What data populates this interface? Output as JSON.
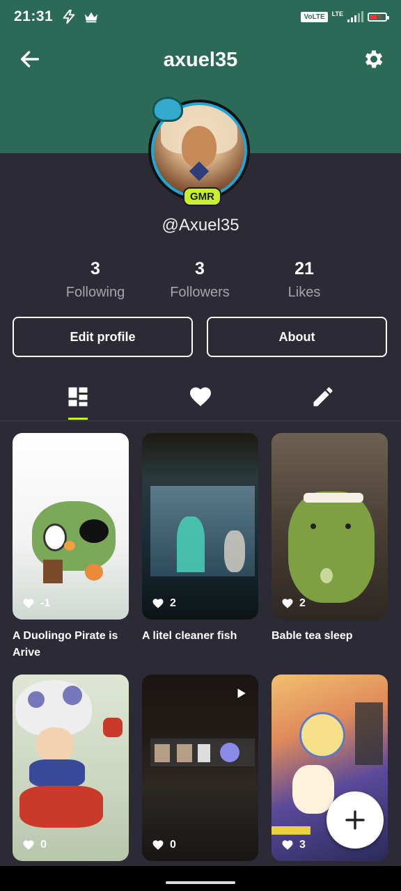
{
  "status_bar": {
    "time": "21:31",
    "icons": [
      "bolt-icon",
      "crown-icon"
    ],
    "volte": "VoLTE",
    "network": "LTE",
    "battery_text": "15"
  },
  "header": {
    "title": "axuel35",
    "back_icon": "back-arrow-icon",
    "settings_icon": "gear-icon",
    "color": "#2b6a56"
  },
  "profile": {
    "badge": "GMR",
    "handle": "@Axuel35",
    "stats": [
      {
        "value": "3",
        "label": "Following"
      },
      {
        "value": "3",
        "label": "Followers"
      },
      {
        "value": "21",
        "label": "Likes"
      }
    ],
    "buttons": {
      "edit": "Edit profile",
      "about": "About"
    }
  },
  "tabs": [
    {
      "icon": "grid-layout-icon",
      "active": true
    },
    {
      "icon": "heart-icon",
      "active": false
    },
    {
      "icon": "pencil-icon",
      "active": false
    }
  ],
  "posts": [
    {
      "likes": "-1",
      "title": "A Duolingo Pirate is Arive"
    },
    {
      "likes": "2",
      "title": "A litel cleaner fish"
    },
    {
      "likes": "2",
      "title": "Bable tea sleep"
    },
    {
      "likes": "0",
      "title": ""
    },
    {
      "likes": "0",
      "title": ""
    },
    {
      "likes": "3",
      "title": ""
    }
  ],
  "fab_icon": "plus-icon",
  "accent": "#c8f02d"
}
